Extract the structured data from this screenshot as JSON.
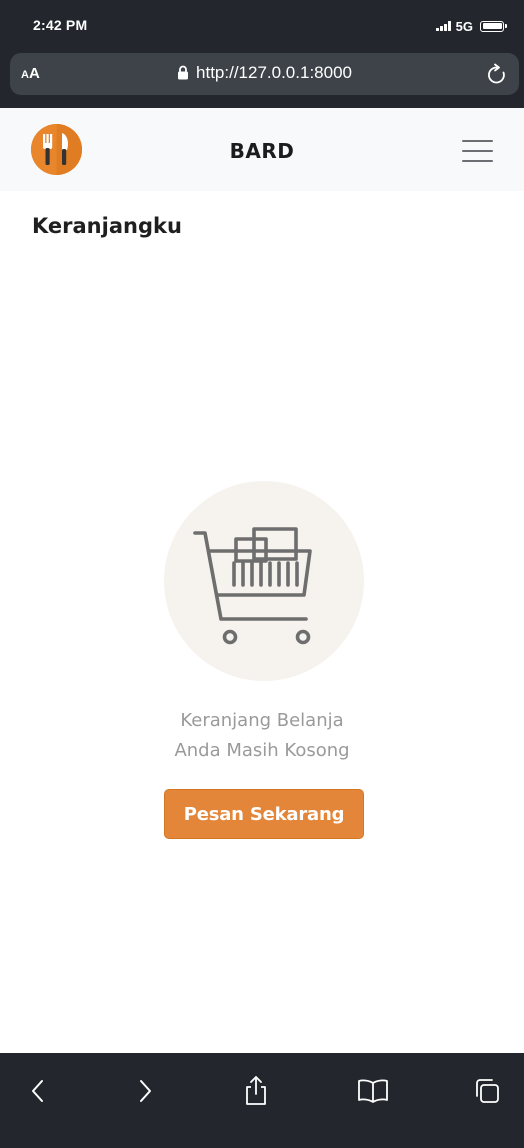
{
  "status_bar": {
    "time": "2:42 PM",
    "network": "5G"
  },
  "browser": {
    "text_size_label_small": "A",
    "text_size_label_big": "A",
    "url": "http://127.0.0.1:8000",
    "icons": {
      "lock": "lock-icon",
      "reload": "reload-icon",
      "back": "chevron-left-icon",
      "forward": "chevron-right-icon",
      "share": "share-icon",
      "bookmarks": "book-icon",
      "tabs": "tabs-icon"
    }
  },
  "navbar": {
    "brand": "BARD",
    "logo_icon": "utensils-logo-icon",
    "menu_icon": "hamburger-menu-icon"
  },
  "page": {
    "title": "Keranjangku",
    "empty_icon": "shopping-cart-icon",
    "empty_message_line1": "Keranjang Belanja",
    "empty_message_line2": "Anda Masih Kosong",
    "cta_label": "Pesan Sekarang"
  },
  "colors": {
    "accent": "#e3863a",
    "browser_chrome": "#23272d",
    "navbar_bg": "#f8f9fa",
    "illustration_bg": "#f6f3ef"
  }
}
